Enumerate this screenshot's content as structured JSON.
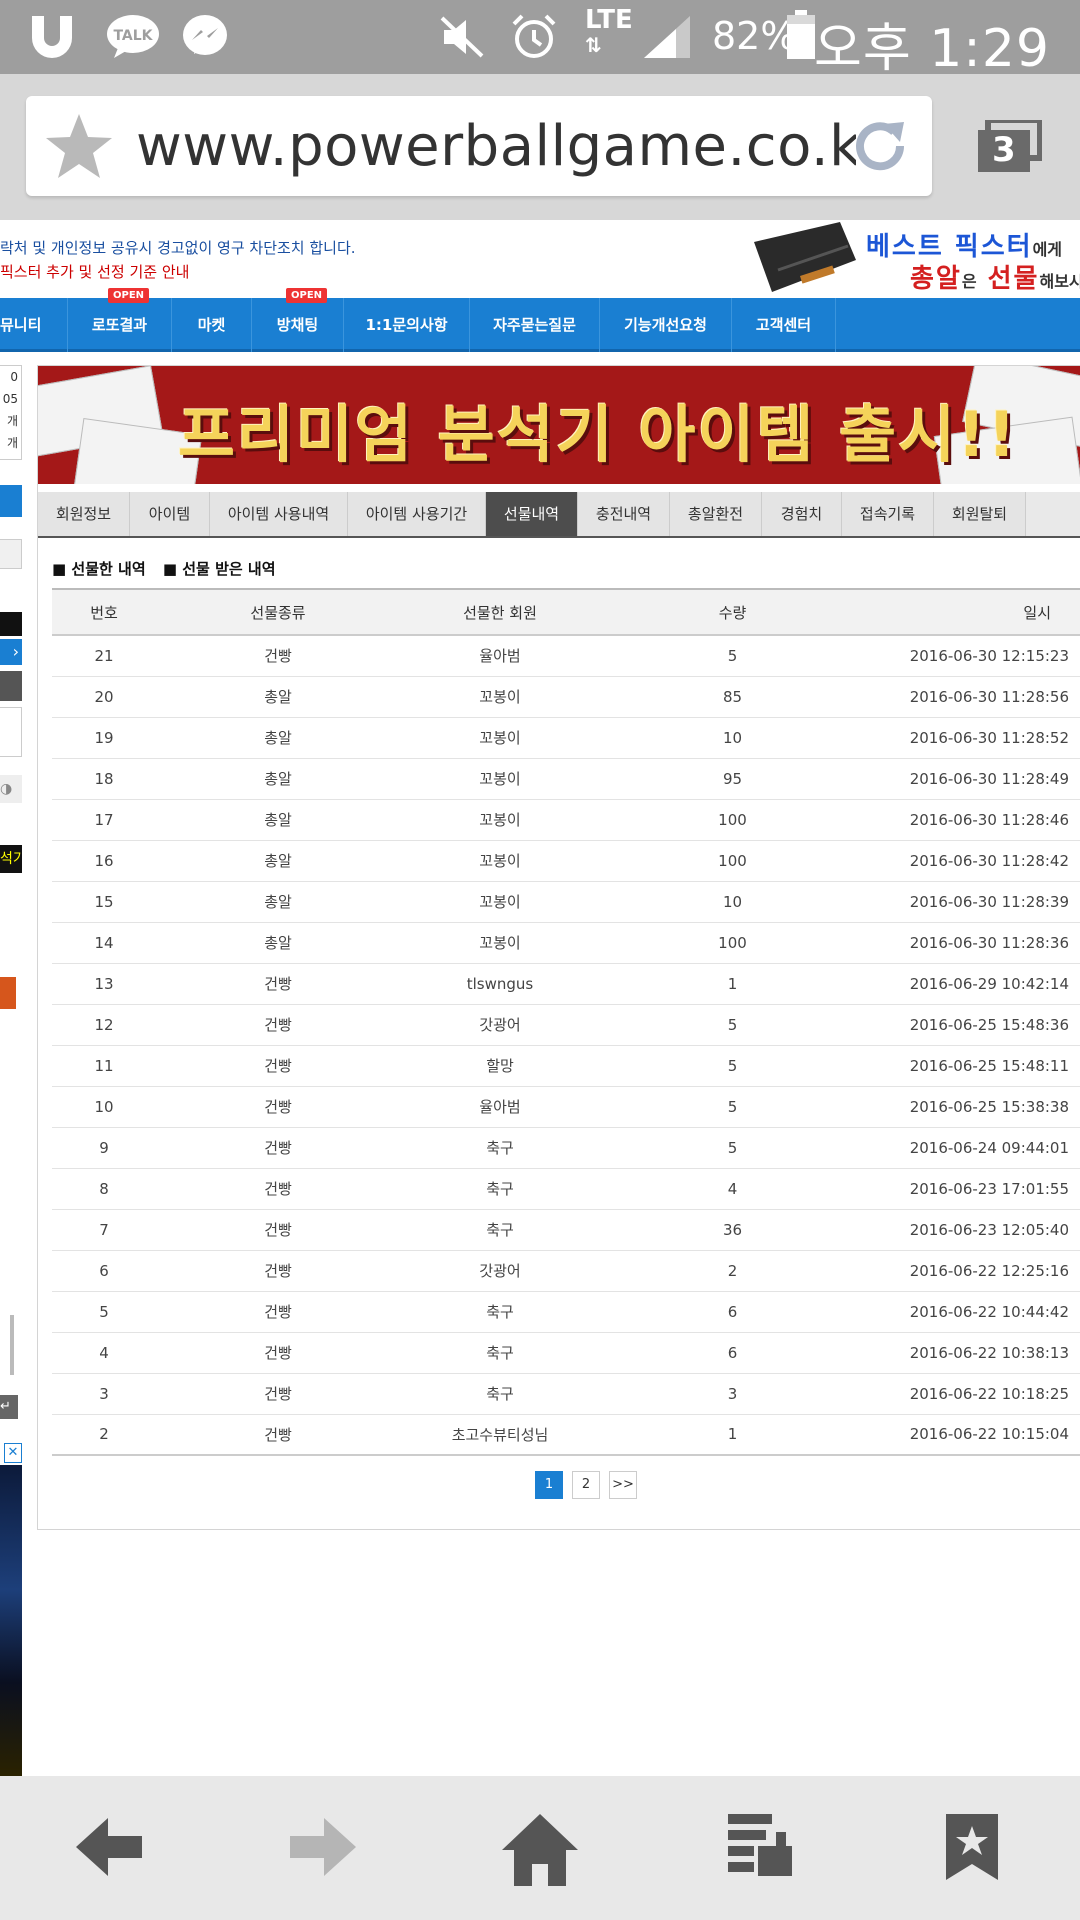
{
  "status_bar": {
    "battery_percent": "82%",
    "time": "오후 1:29",
    "network": "LTE",
    "icons": [
      "uplus-icon",
      "talk-icon",
      "messenger-icon",
      "mute-icon",
      "alarm-icon",
      "lte-icon",
      "signal-icon",
      "battery-icon"
    ]
  },
  "browser": {
    "url": "www.powerballgame.co.kr/",
    "tab_count": "3"
  },
  "page": {
    "notice_line1": "락처 및 개인정보 공유시 경고없이 영구 차단조치 합니다.",
    "notice_line2": "픽스터 추가 및 선정 기준 안내",
    "ad": {
      "line1": "베스트 픽스터",
      "line1_suffix": "에게",
      "line2_a": "총알",
      "line2_b": "은",
      "line2_c": "선물",
      "line2_suffix": "해보시"
    },
    "nav": [
      {
        "label": "뮤니티",
        "badge": ""
      },
      {
        "label": "로또결과",
        "badge": "OPEN"
      },
      {
        "label": "마켓",
        "badge": ""
      },
      {
        "label": "방채팅",
        "badge": "OPEN"
      },
      {
        "label": "1:1문의사항",
        "badge": ""
      },
      {
        "label": "자주묻는질문",
        "badge": ""
      },
      {
        "label": "기능개선요청",
        "badge": ""
      },
      {
        "label": "고객센터",
        "badge": ""
      }
    ],
    "sidebar_fragments": [
      "0",
      "05",
      "개",
      "개",
      "석기"
    ],
    "hero_text": "프리미엄 분석기 아이템 출시!!",
    "tabs": [
      "회원정보",
      "아이템",
      "아이템 사용내역",
      "아이템 사용기간",
      "선물내역",
      "충전내역",
      "총알환전",
      "경험치",
      "접속기록",
      "회원탈퇴"
    ],
    "active_tab": "선물내역",
    "subtabs": [
      "■ 선물한 내역",
      "■ 선물 받은 내역"
    ],
    "table": {
      "headers": [
        "번호",
        "선물종류",
        "선물한 회원",
        "수량",
        "일시"
      ],
      "rows": [
        [
          "21",
          "건빵",
          "율아범",
          "5",
          "2016-06-30 12:15:23"
        ],
        [
          "20",
          "총알",
          "꼬봉이",
          "85",
          "2016-06-30 11:28:56"
        ],
        [
          "19",
          "총알",
          "꼬봉이",
          "10",
          "2016-06-30 11:28:52"
        ],
        [
          "18",
          "총알",
          "꼬봉이",
          "95",
          "2016-06-30 11:28:49"
        ],
        [
          "17",
          "총알",
          "꼬봉이",
          "100",
          "2016-06-30 11:28:46"
        ],
        [
          "16",
          "총알",
          "꼬봉이",
          "100",
          "2016-06-30 11:28:42"
        ],
        [
          "15",
          "총알",
          "꼬봉이",
          "10",
          "2016-06-30 11:28:39"
        ],
        [
          "14",
          "총알",
          "꼬봉이",
          "100",
          "2016-06-30 11:28:36"
        ],
        [
          "13",
          "건빵",
          "tlswngus",
          "1",
          "2016-06-29 10:42:14"
        ],
        [
          "12",
          "건빵",
          "갓광어",
          "5",
          "2016-06-25 15:48:36"
        ],
        [
          "11",
          "건빵",
          "할망",
          "5",
          "2016-06-25 15:48:11"
        ],
        [
          "10",
          "건빵",
          "율아범",
          "5",
          "2016-06-25 15:38:38"
        ],
        [
          "9",
          "건빵",
          "축구",
          "5",
          "2016-06-24 09:44:01"
        ],
        [
          "8",
          "건빵",
          "축구",
          "4",
          "2016-06-23 17:01:55"
        ],
        [
          "7",
          "건빵",
          "축구",
          "36",
          "2016-06-23 12:05:40"
        ],
        [
          "6",
          "건빵",
          "갓광어",
          "2",
          "2016-06-22 12:25:16"
        ],
        [
          "5",
          "건빵",
          "축구",
          "6",
          "2016-06-22 10:44:42"
        ],
        [
          "4",
          "건빵",
          "축구",
          "6",
          "2016-06-22 10:38:13"
        ],
        [
          "3",
          "건빵",
          "축구",
          "3",
          "2016-06-22 10:18:25"
        ],
        [
          "2",
          "건빵",
          "초고수뷰티성님",
          "1",
          "2016-06-22 10:15:04"
        ]
      ]
    },
    "pagination": [
      "1",
      "2",
      ">>"
    ],
    "current_page": "1"
  },
  "bottom_bar": {
    "icons": [
      "back-arrow-icon",
      "forward-arrow-icon",
      "home-icon",
      "reader-icon",
      "bookmark-icon"
    ]
  },
  "colors": {
    "accent_blue": "#1a7fd2",
    "status_gray": "#9e9e9e",
    "hero_red": "#a41818",
    "active_tab": "#4d4d4d"
  }
}
